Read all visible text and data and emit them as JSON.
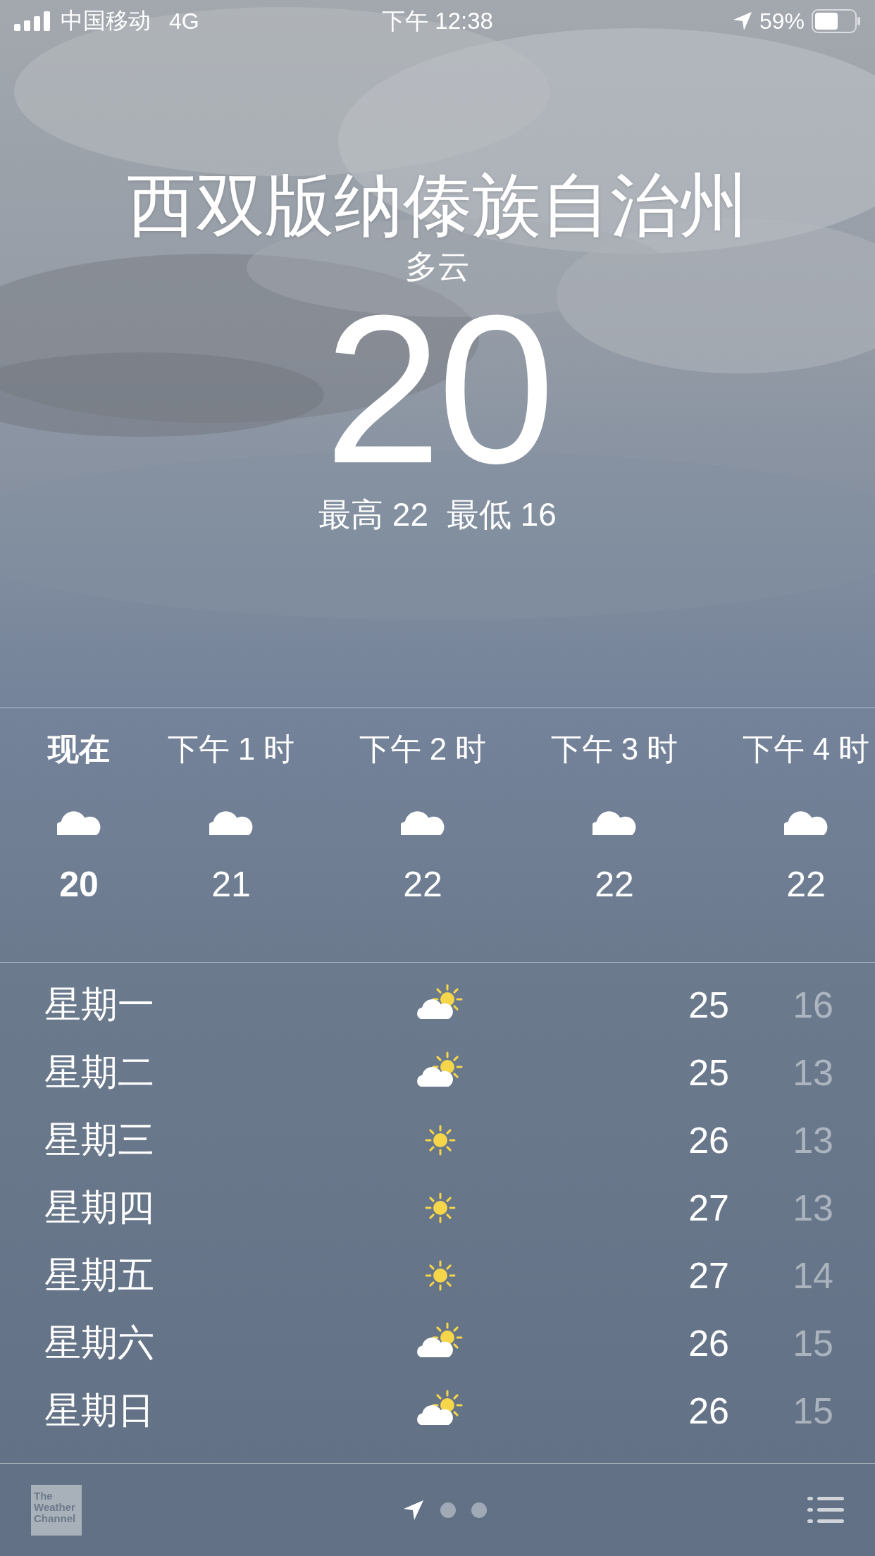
{
  "status_bar": {
    "carrier": "中国移动",
    "network": "4G",
    "time": "下午 12:38",
    "battery": "59%"
  },
  "location": {
    "city": "西双版纳傣族自治州",
    "condition": "多云",
    "temperature": "20",
    "high": "最高 22",
    "low": "最低 16"
  },
  "hourly": [
    {
      "time": "现在",
      "temperature": "20",
      "selected": true
    },
    {
      "time": "下午 1 时",
      "temperature": "21",
      "selected": false
    },
    {
      "time": "下午 2 时",
      "temperature": "22",
      "selected": false
    },
    {
      "time": "下午 3 时",
      "temperature": "22",
      "selected": false
    },
    {
      "time": "下午 4 时",
      "temperature": "22",
      "selected": false
    }
  ],
  "daily": [
    {
      "day": "星期一",
      "kind": "partly-cloudy",
      "high": "25",
      "low": "16"
    },
    {
      "day": "星期二",
      "kind": "partly-cloudy",
      "high": "25",
      "low": "13"
    },
    {
      "day": "星期三",
      "kind": "sunny",
      "high": "26",
      "low": "13"
    },
    {
      "day": "星期四",
      "kind": "sunny",
      "high": "27",
      "low": "13"
    },
    {
      "day": "星期五",
      "kind": "sunny",
      "high": "27",
      "low": "14"
    },
    {
      "day": "星期六",
      "kind": "partly-cloudy",
      "high": "26",
      "low": "15"
    },
    {
      "day": "星期日",
      "kind": "partly-cloudy",
      "high": "26",
      "low": "15"
    }
  ],
  "bottom_bar": {
    "logo": "The Weather Channel",
    "pages": [
      {
        "kind": "location",
        "selected": true
      },
      {
        "kind": "city",
        "selected": false
      },
      {
        "kind": "city",
        "selected": false
      }
    ]
  }
}
